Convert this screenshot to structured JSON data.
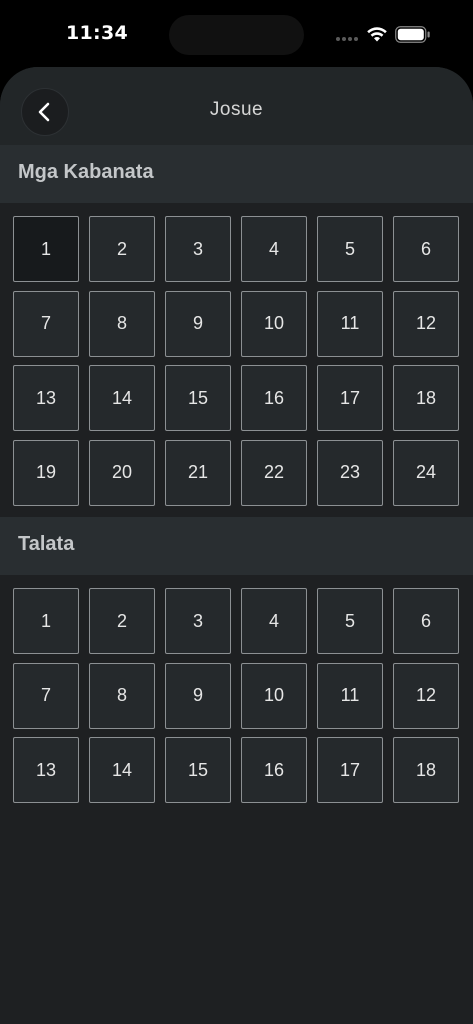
{
  "status_bar": {
    "time": "11:34",
    "icons": [
      "cellular-signal-icon",
      "wifi-icon",
      "battery-icon"
    ]
  },
  "nav": {
    "back_icon": "chevron-left-icon",
    "title": "Josue"
  },
  "sections": [
    {
      "title": "Mga Kabanata",
      "items": [
        "1",
        "2",
        "3",
        "4",
        "5",
        "6",
        "7",
        "8",
        "9",
        "10",
        "11",
        "12",
        "13",
        "14",
        "15",
        "16",
        "17",
        "18",
        "19",
        "20",
        "21",
        "22",
        "23",
        "24"
      ],
      "selected": "1"
    },
    {
      "title": "Talata",
      "items": [
        "1",
        "2",
        "3",
        "4",
        "5",
        "6",
        "7",
        "8",
        "9",
        "10",
        "11",
        "12",
        "13",
        "14",
        "15",
        "16",
        "17",
        "18"
      ]
    }
  ],
  "colors": {
    "background": "#1e2022",
    "header": "#292e31",
    "cell_border": "#8c9093",
    "cell_fill": "#25292c"
  }
}
